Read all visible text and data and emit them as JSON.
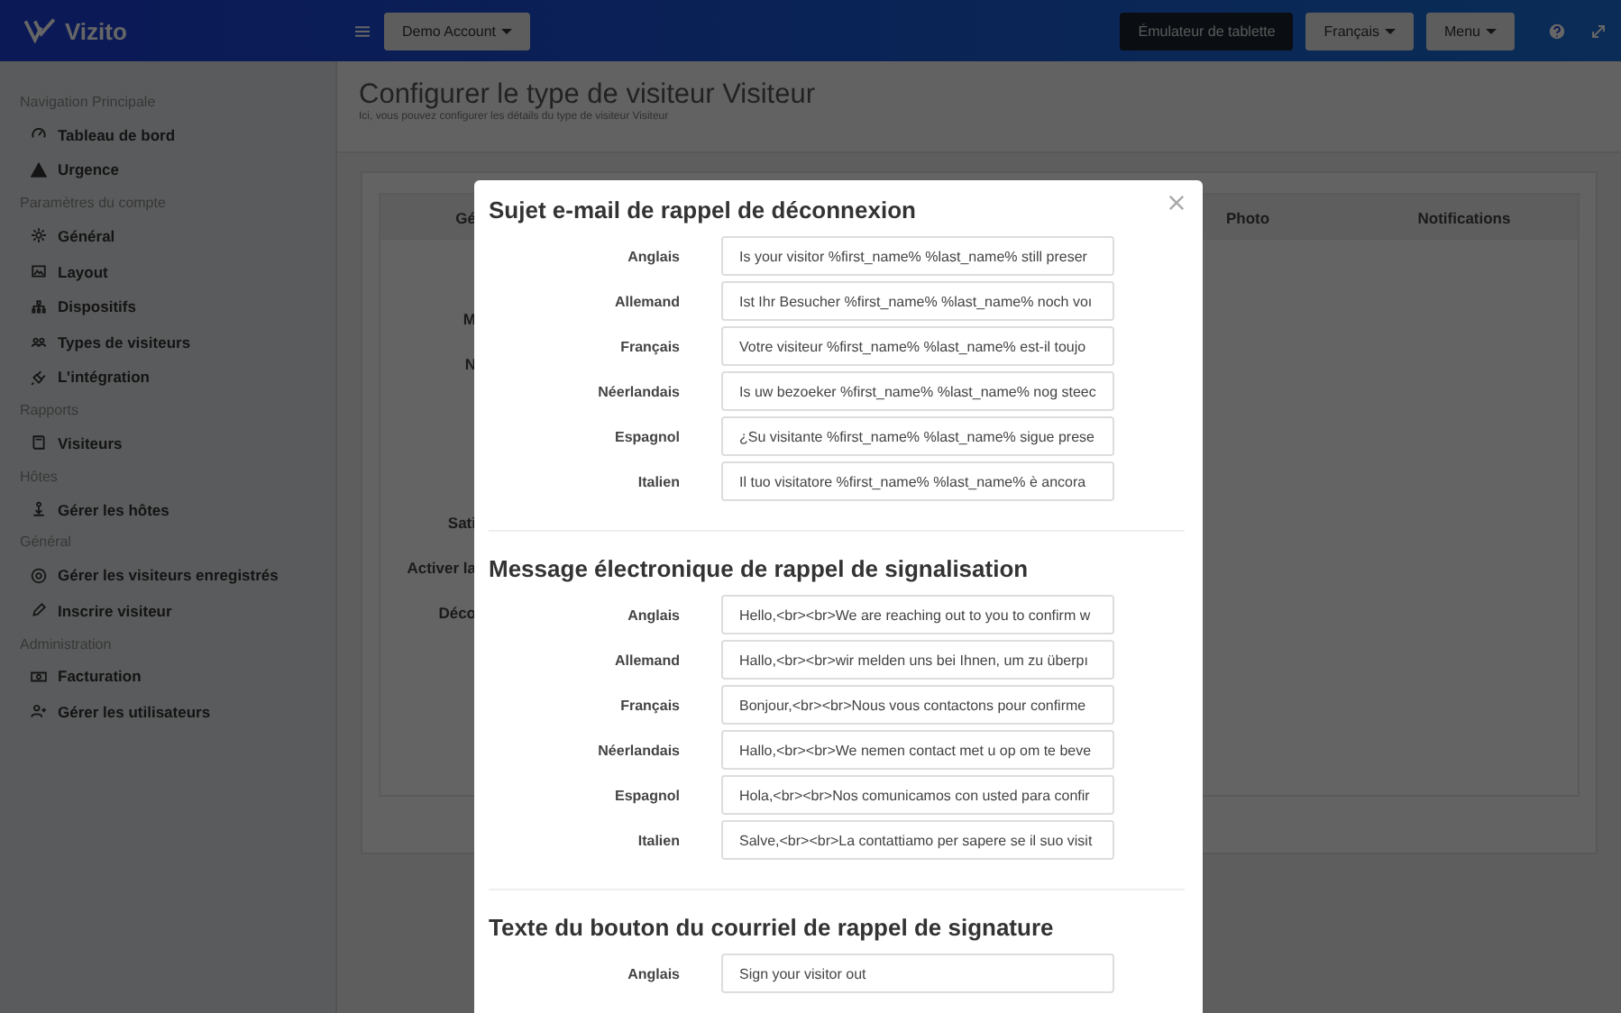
{
  "topbar": {
    "brand": "Vizito",
    "account_button": "Demo Account",
    "emulator_button": "Émulateur de tablette",
    "language_button": "Français",
    "menu_button": "Menu"
  },
  "sidebar": {
    "sections": [
      {
        "heading": "Navigation Principale",
        "items": [
          {
            "label": "Tableau de bord"
          },
          {
            "label": "Urgence"
          }
        ]
      },
      {
        "heading": "Paramètres du compte",
        "items": [
          {
            "label": "Général"
          },
          {
            "label": "Layout"
          },
          {
            "label": "Dispositifs"
          },
          {
            "label": "Types de visiteurs"
          },
          {
            "label": "L’intégration"
          }
        ]
      },
      {
        "heading": "Rapports",
        "items": [
          {
            "label": "Visiteurs"
          }
        ]
      },
      {
        "heading": "Hôtes",
        "items": [
          {
            "label": "Gérer les hôtes"
          }
        ]
      },
      {
        "heading": "Général",
        "items": [
          {
            "label": "Gérer les visiteurs enregistrés"
          },
          {
            "label": "Inscrire visiteur"
          }
        ]
      },
      {
        "heading": "Administration",
        "items": [
          {
            "label": "Facturation"
          },
          {
            "label": "Gérer les utilisateurs"
          }
        ]
      }
    ]
  },
  "page": {
    "title": "Configurer le type de visiteur Visiteur",
    "subtitle": "Ici, vous pouvez configurer les détails du type de visiteur Visiteur"
  },
  "background_table": {
    "columns": [
      "Gé",
      "Photo",
      "Notifications"
    ],
    "labels_top": [
      "M",
      "N"
    ],
    "labels_bottom": [
      "Sati",
      "Activer la",
      "Déco"
    ]
  },
  "modal": {
    "sections": [
      {
        "title": "Sujet e-mail de rappel de déconnexion",
        "rows": [
          {
            "label": "Anglais",
            "value": "Is your visitor %first_name% %last_name% still preser"
          },
          {
            "label": "Allemand",
            "value": "Ist Ihr Besucher %first_name% %last_name% noch voı"
          },
          {
            "label": "Français",
            "value": "Votre visiteur %first_name% %last_name% est-il toujo"
          },
          {
            "label": "Néerlandais",
            "value": "Is uw bezoeker %first_name% %last_name% nog steec"
          },
          {
            "label": "Espagnol",
            "value": "¿Su visitante %first_name% %last_name% sigue prese"
          },
          {
            "label": "Italien",
            "value": "Il tuo visitatore %first_name% %last_name% è ancora"
          }
        ]
      },
      {
        "title": "Message électronique de rappel de signalisation",
        "rows": [
          {
            "label": "Anglais",
            "value": "Hello,<br><br>We are reaching out to you to confirm w"
          },
          {
            "label": "Allemand",
            "value": "Hallo,<br><br>wir melden uns bei Ihnen, um zu überpı"
          },
          {
            "label": "Français",
            "value": "Bonjour,<br><br>Nous vous contactons pour confirme"
          },
          {
            "label": "Néerlandais",
            "value": "Hallo,<br><br>We nemen contact met u op om te beve"
          },
          {
            "label": "Espagnol",
            "value": "Hola,<br><br>Nos comunicamos con usted para confir"
          },
          {
            "label": "Italien",
            "value": "Salve,<br><br>La contattiamo per sapere se il suo visit"
          }
        ]
      },
      {
        "title": "Texte du bouton du courriel de rappel de signature",
        "rows": [
          {
            "label": "Anglais",
            "value": "Sign your visitor out"
          }
        ]
      }
    ]
  }
}
